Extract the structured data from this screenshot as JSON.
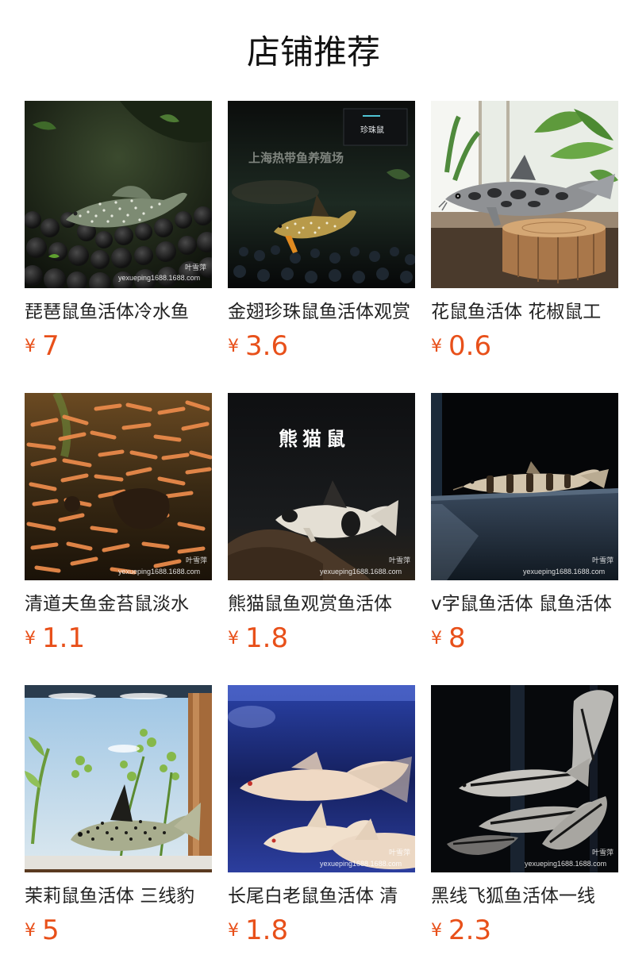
{
  "header": {
    "title": "店铺推荐"
  },
  "products": [
    {
      "name": "琵琶鼠鱼活体冷水鱼",
      "currency": "¥",
      "price": "7",
      "image": "spotted-pleco-fish",
      "watermarks": [
        "叶雪萍",
        "yexueping1688.1688.com"
      ]
    },
    {
      "name": "金翅珍珠鼠鱼活体观赏",
      "currency": "¥",
      "price": "3.6",
      "image": "pearl-cory-fish",
      "overlay_text": "上海热带鱼养殖场",
      "badge_text": "珍珠鼠",
      "watermarks": []
    },
    {
      "name": "花鼠鱼活体 花椒鼠工",
      "currency": "¥",
      "price": "0.6",
      "image": "peppered-cory-on-stand",
      "watermarks": []
    },
    {
      "name": "清道夫鱼金苔鼠淡水",
      "currency": "¥",
      "price": "1.1",
      "image": "golden-algae-eater-school",
      "watermarks": [
        "叶雪萍",
        "yexueping1688.1688.com"
      ]
    },
    {
      "name": "熊猫鼠鱼观赏鱼活体",
      "currency": "¥",
      "price": "1.8",
      "image": "panda-cory-fish",
      "overlay_text": "熊猫鼠",
      "watermarks": [
        "叶雪萍",
        "yexueping1688.1688.com"
      ]
    },
    {
      "name": "v字鼠鱼活体 鼠鱼活体",
      "currency": "¥",
      "price": "8",
      "image": "striped-loach-fish",
      "watermarks": [
        "叶雪萍",
        "yexueping1688.1688.com"
      ]
    },
    {
      "name": "茉莉鼠鱼活体 三线豹",
      "currency": "¥",
      "price": "5",
      "image": "julii-cory-in-tank",
      "watermarks": []
    },
    {
      "name": "长尾白老鼠鱼活体 清",
      "currency": "¥",
      "price": "1.8",
      "image": "albino-longfin-cory",
      "watermarks": [
        "叶雪萍",
        "yexueping1688.1688.com"
      ]
    },
    {
      "name": "黑线飞狐鱼活体一线",
      "currency": "¥",
      "price": "2.3",
      "image": "siamese-algae-eater-school",
      "watermarks": [
        "叶雪萍",
        "yexueping1688.1688.com"
      ]
    }
  ]
}
